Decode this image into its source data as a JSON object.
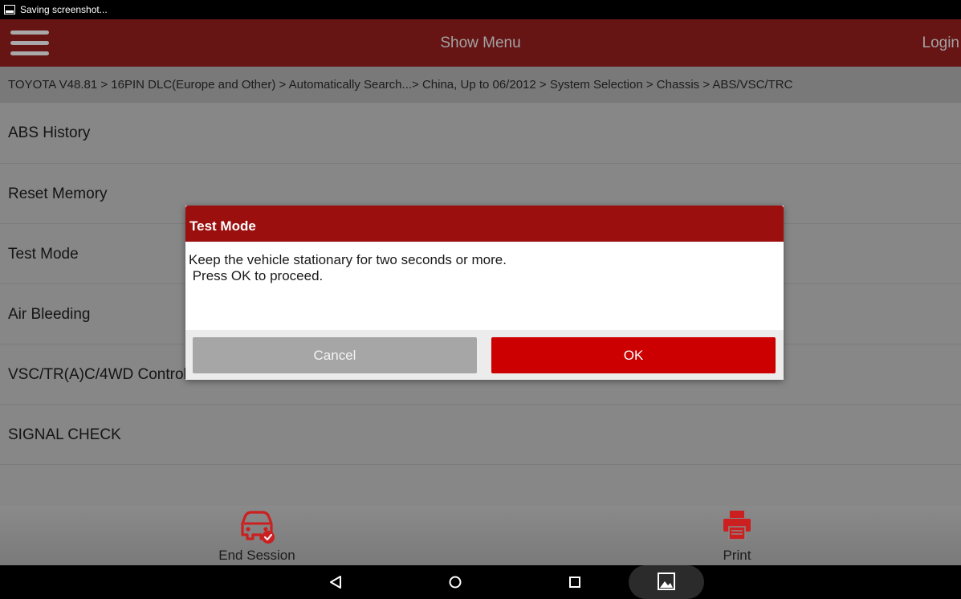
{
  "status_bar": {
    "text": "Saving screenshot..."
  },
  "header": {
    "title": "Show Menu",
    "login_label": "Login"
  },
  "breadcrumb": "TOYOTA V48.81 > 16PIN DLC(Europe and Other) > Automatically Search...> China, Up to 06/2012 > System Selection > Chassis > ABS/VSC/TRC",
  "menu": {
    "items": [
      {
        "label": "ABS History"
      },
      {
        "label": "Reset Memory"
      },
      {
        "label": "Test Mode"
      },
      {
        "label": "Air Bleeding"
      },
      {
        "label": "VSC/TR(A)C/4WD Control Prohibition Mode"
      },
      {
        "label": "SIGNAL CHECK"
      }
    ]
  },
  "bottom_bar": {
    "end_session": {
      "label": "End Session",
      "icon": "car-check-icon"
    },
    "print": {
      "label": "Print",
      "icon": "printer-icon"
    }
  },
  "dialog": {
    "title": "Test Mode",
    "message_line1": "Keep the vehicle stationary for two seconds or more.",
    "message_line2": " Press OK to proceed.",
    "cancel_label": "Cancel",
    "ok_label": "OK"
  },
  "colors": {
    "header_red": "#9b0f0f",
    "ok_button": "#cc0000",
    "cancel_button": "#a6a6a6"
  }
}
